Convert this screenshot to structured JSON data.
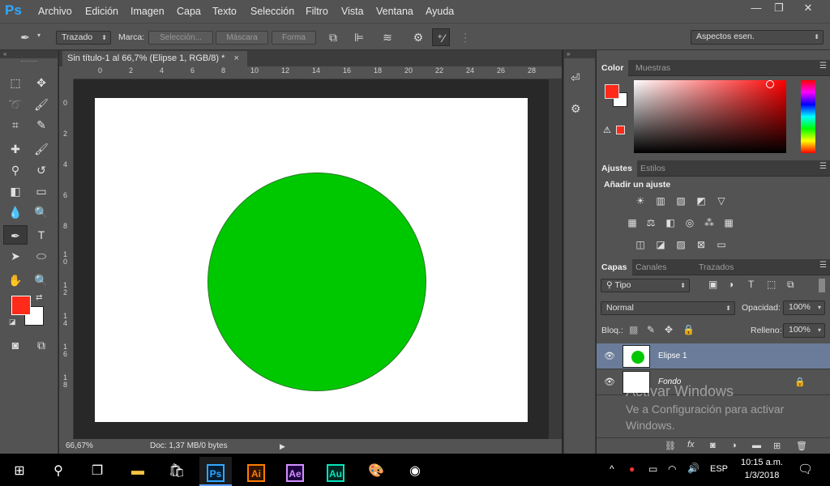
{
  "app": {
    "logo": "Ps"
  },
  "menu": [
    "Archivo",
    "Edición",
    "Imagen",
    "Capa",
    "Texto",
    "Selección",
    "Filtro",
    "Vista",
    "Ventana",
    "Ayuda"
  ],
  "window_controls": {
    "minimize": "—",
    "restore": "❐",
    "close": "✕"
  },
  "options_bar": {
    "tool_mode": "Trazado",
    "marca_label": "Marca:",
    "seleccion": "Selección...",
    "mascara": "Máscara",
    "forma": "Forma",
    "workspace": "Aspectos esen."
  },
  "document": {
    "tab_title": "Sin título-1 al 66,7% (Elipse 1, RGB/8) *",
    "close": "×",
    "ruler_top": [
      "0",
      "2",
      "4",
      "6",
      "8",
      "10",
      "12",
      "14",
      "16",
      "18",
      "20",
      "22",
      "24",
      "26",
      "28"
    ],
    "ruler_left": [
      "0",
      "2",
      "4",
      "6",
      "8",
      "1\n0",
      "1\n2",
      "1\n4",
      "1\n6",
      "1\n8"
    ],
    "zoom": "66,67%",
    "doc_info": "Doc: 1,37 MB/0 bytes",
    "ellipse_color": "#00c800"
  },
  "colors": {
    "foreground": "#ff2a1a",
    "background": "#ffffff"
  },
  "color_panel": {
    "tab_color": "Color",
    "tab_swatches": "Muestras",
    "current": "#ff2a1a"
  },
  "adjustments_panel": {
    "tab_adjust": "Ajustes",
    "tab_styles": "Estilos",
    "heading": "Añadir un ajuste"
  },
  "layers_panel": {
    "tab_layers": "Capas",
    "tab_channels": "Canales",
    "tab_paths": "Trazados",
    "filter": "Tipo",
    "blend_mode": "Normal",
    "opacity_label": "Opacidad:",
    "opacity": "100%",
    "lock_label": "Bloq.:",
    "fill_label": "Relleno:",
    "fill": "100%",
    "layers": [
      {
        "name": "Elipse 1"
      },
      {
        "name": "Fondo"
      }
    ]
  },
  "activation": {
    "title": "Activar Windows",
    "line1": "Ve a Configuración para activar",
    "line2": "Windows."
  },
  "taskbar": {
    "apps": [
      {
        "label": "Ps",
        "color": "#31a8ff"
      },
      {
        "label": "Ai",
        "color": "#ff7c00"
      },
      {
        "label": "Ae",
        "color": "#d291ff"
      },
      {
        "label": "Au",
        "color": "#00e4bb"
      }
    ],
    "lang": "ESP",
    "time": "10:15 a.m.",
    "date": "1/3/2018"
  }
}
